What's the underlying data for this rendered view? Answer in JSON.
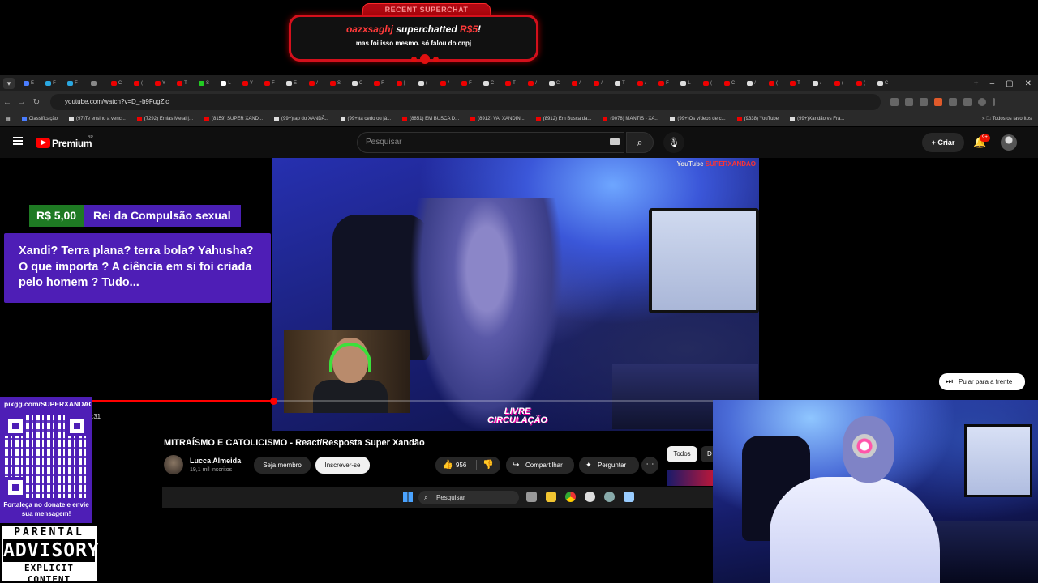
{
  "superchat": {
    "header": "RECENT SUPERCHAT",
    "user": "oazxsaghj",
    "verb": " superchatted ",
    "amount": "R$5",
    "exclaim": "!",
    "message": "mas foi isso mesmo. só falou do cnpj"
  },
  "browser": {
    "url": "youtube.com/watch?v=D_-b9FugZlc",
    "tab_labels": [
      "E",
      "F",
      "F",
      "",
      "C",
      "(",
      "Y",
      "T",
      "S",
      "L",
      "Y",
      "F",
      "E",
      "/",
      "S",
      "C",
      "F",
      "[",
      "(",
      "/",
      "F",
      "C",
      "T",
      "/",
      "C",
      "/",
      "/",
      "T",
      "/",
      "F",
      "L",
      "(",
      "C",
      "/",
      "(",
      "T",
      "/",
      "(",
      "(",
      "C"
    ],
    "bookmarks": [
      "Classificação",
      "(97)Te ensino a venc...",
      "(7292) Emlas Metal |...",
      "(8159) SUPER XAND...",
      "(99+)rap do XANDÃ...",
      "(99+)tá cedo ou já...",
      "(8851) EM BUSCA D...",
      "(8912) VAI XANDIN...",
      "(8912) Em Busca da...",
      "(9078) MANTIS - XA...",
      "(99+)Os vídeos de c...",
      "(9338) YouTube",
      "(99+)Xandão vs Fra..."
    ],
    "bookmarks_all": "Todos os favoritos"
  },
  "youtube": {
    "brand": "Premium",
    "country": "BR",
    "search_placeholder": "Pesquisar",
    "create_label": "Criar",
    "notif_badge": "9+",
    "watermark_prefix": "YouTube",
    "watermark_name": "SUPERXANDAO",
    "video_overlay_line1": "LIVRE",
    "video_overlay_line2": "CIRCULAÇÃO",
    "time_fragment": ":31",
    "skip_label": "Pular para a frente",
    "progress_fraction": 0.36,
    "video_title": "MITRAÍSMO E CATOLICISMO - React/Resposta Super Xandão",
    "channel_name": "Lucca Almeida",
    "channel_subs": "19,1 mil inscritos",
    "member_label": "Seja membro",
    "subscribe_label": "Inscrever-se",
    "like_count": "956",
    "share_label": "Compartilhar",
    "ask_label": "Perguntar",
    "chip_all": "Todos",
    "chip_next": "D"
  },
  "donation": {
    "amount": "R$ 5,00",
    "name": "Rei da Compulsão sexual",
    "message": "Xandi? Terra plana? terra bola? Yahusha? O que importa ? A ciência em si foi criada pelo homem ? Tudo..."
  },
  "taskbar": {
    "search_label": "Pesquisar"
  },
  "pix": {
    "url": "pixgg.com/SUPERXANDAO",
    "caption": "Fortaleça no donate e envie sua mensagem!"
  },
  "advisory": {
    "line1": "PARENTAL",
    "line2": "ADVISORY",
    "line3": "EXPLICIT CONTENT"
  },
  "colors": {
    "superchat_red": "#d4101c",
    "donation_purple": "#4e1eb6",
    "donation_green": "#1e7a23",
    "youtube_red": "#ff0000"
  }
}
